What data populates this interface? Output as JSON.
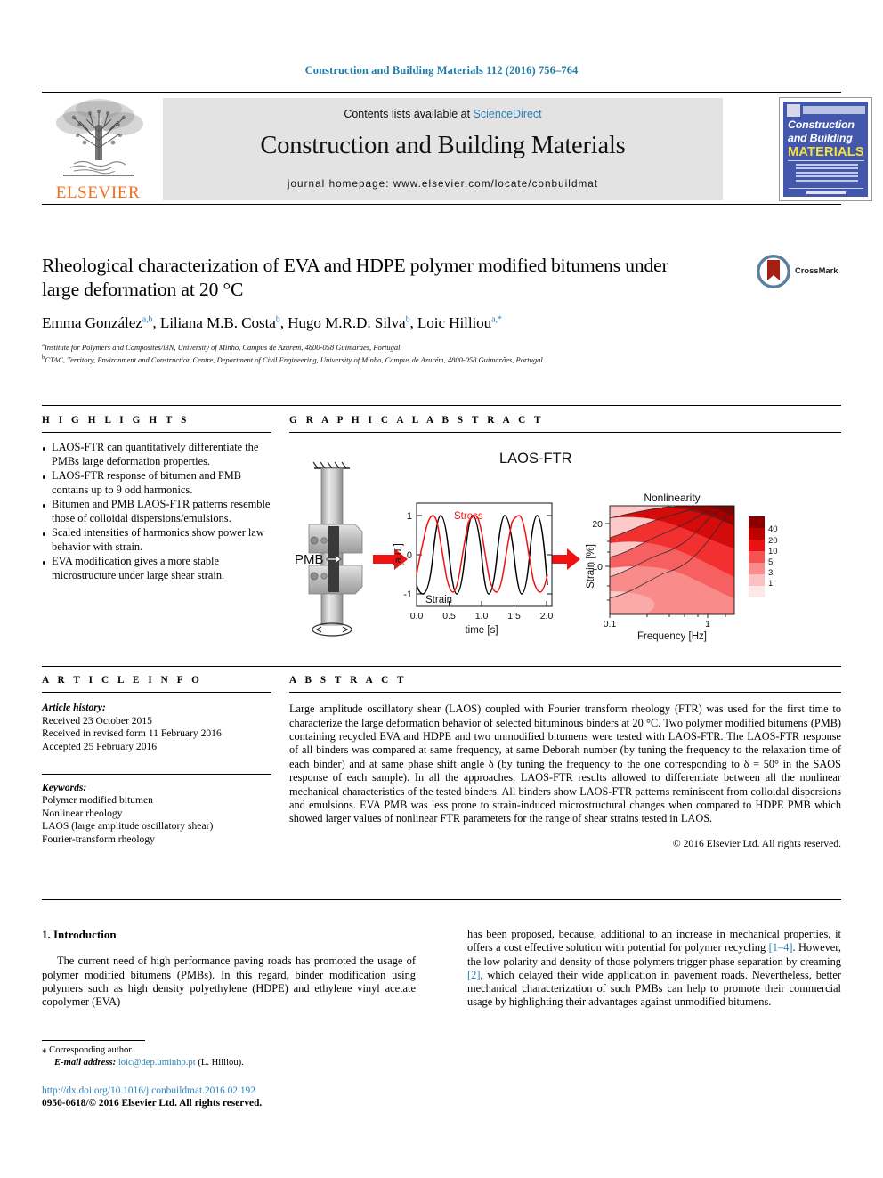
{
  "running_head": "Construction and Building Materials 112 (2016) 756–764",
  "masthead": {
    "contents_prefix": "Contents lists available at ",
    "sciencedirect": "ScienceDirect",
    "journal_title": "Construction and Building Materials",
    "homepage": "journal homepage: www.elsevier.com/locate/conbuildmat",
    "publisher": "ELSEVIER",
    "cover": {
      "line1": "Construction",
      "line2": "and Building",
      "line3": "MATERIALS"
    }
  },
  "article": {
    "title": "Rheological characterization of EVA and HDPE polymer modified bitumens under large deformation at 20 °C",
    "crossmark_label": "CrossMark",
    "authors": [
      {
        "name": "Emma González",
        "sup": "a,b",
        "sep": ", "
      },
      {
        "name": "Liliana M.B. Costa",
        "sup": "b",
        "sep": ", "
      },
      {
        "name": "Hugo M.R.D. Silva",
        "sup": "b",
        "sep": ", "
      },
      {
        "name": "Loic Hilliou",
        "sup": "a,*",
        "sep": ""
      }
    ],
    "affiliations": [
      {
        "marker": "a",
        "text": "Institute for Polymers and Composites/i3N, University of Minho, Campus de Azurém, 4800-058 Guimarães, Portugal"
      },
      {
        "marker": "b",
        "text": "CTAC, Territory, Environment and Construction Centre, Department of Civil Engineering, University of Minho, Campus de Azurém, 4800-058 Guimarães, Portugal"
      }
    ]
  },
  "highlights": {
    "heading": "H I G H L I G H T S",
    "items": [
      "LAOS-FTR can quantitatively differentiate the PMBs large deformation properties.",
      "LAOS-FTR response of bitumen and PMB contains up to 9 odd harmonics.",
      "Bitumen and PMB LAOS-FTR patterns resemble those of colloidal dispersions/emulsions.",
      "Scaled intensities of harmonics show power law behavior with strain.",
      "EVA modification gives a more stable microstructure under large shear strain."
    ]
  },
  "graphical_abstract": {
    "heading": "G R A P H I C A L   A B S T R A C T"
  },
  "article_info": {
    "heading": "A R T I C L E   I N F O",
    "history_label": "Article history:",
    "history": [
      "Received 23 October 2015",
      "Received in revised form 11 February 2016",
      "Accepted 25 February 2016"
    ],
    "keywords_label": "Keywords:",
    "keywords": [
      "Polymer modified bitumen",
      "Nonlinear rheology",
      "LAOS (large amplitude oscillatory shear)",
      "Fourier-transform rheology"
    ]
  },
  "abstract": {
    "heading": "A B S T R A C T",
    "text": "Large amplitude oscillatory shear (LAOS) coupled with Fourier transform rheology (FTR) was used for the first time to characterize the large deformation behavior of selected bituminous binders at 20 °C. Two polymer modified bitumens (PMB) containing recycled EVA and HDPE and two unmodified bitumens were tested with LAOS-FTR. The LAOS-FTR response of all binders was compared at same frequency, at same Deborah number (by tuning the frequency to the relaxation time of each binder) and at same phase shift angle δ (by tuning the frequency to the one corresponding to δ = 50° in the SAOS response of each sample). In all the approaches, LAOS-FTR results allowed to differentiate between all the nonlinear mechanical characteristics of the tested binders. All binders show LAOS-FTR patterns reminiscent from colloidal dispersions and emulsions. EVA PMB was less prone to strain-induced microstructural changes when compared to HDPE PMB which showed larger values of nonlinear FTR parameters for the range of shear strains tested in LAOS.",
    "copyright": "© 2016 Elsevier Ltd. All rights reserved."
  },
  "body": {
    "section_number_title": "1. Introduction",
    "left_paragraph": "The current need of high performance paving roads has promoted the usage of polymer modified bitumens (PMBs). In this regard, binder modification using polymers such as high density polyethylene (HDPE) and ethylene vinyl acetate copolymer (EVA)",
    "right_paragraph_1": "has been proposed, because, additional to an increase in mechanical properties, it offers a cost effective solution with potential for polymer recycling ",
    "right_ref_1": "[1–4]",
    "right_paragraph_2": ". However, the low polarity and density of those polymers trigger phase separation by creaming ",
    "right_ref_2": "[2]",
    "right_paragraph_3": ", which delayed their wide application in pavement roads. Nevertheless, better mechanical characterization of such PMBs can help to promote their commercial usage by highlighting their advantages against unmodified bitumens."
  },
  "footer": {
    "corresponding_marker": "⁎",
    "corresponding_text": "Corresponding author.",
    "email_label": "E-mail address:",
    "email": "loic@dep.uminho.pt",
    "email_owner": "(L. Hilliou).",
    "doi": "http://dx.doi.org/10.1016/j.conbuildmat.2016.02.192",
    "issn_line": "0950-0618/© 2016 Elsevier Ltd. All rights reserved."
  },
  "chart_data": [
    {
      "type": "line",
      "title": "LAOS-FTR",
      "xlabel": "time [s]",
      "ylabel": "[a.u.]",
      "xlim": [
        0.0,
        2.0
      ],
      "ylim": [
        -1.35,
        1.35
      ],
      "xticks": [
        "0.0",
        "0.5",
        "1.0",
        "1.5",
        "2.0"
      ],
      "yticks": [
        "-1",
        "0",
        "1"
      ],
      "grid": false,
      "legend_position": "inline-annotation",
      "series": [
        {
          "name": "Stress",
          "color": "#ee1111",
          "amplitude": 1.0,
          "frequency_hz": 2.0,
          "phase_deg": 28,
          "distorted": true
        },
        {
          "name": "Strain",
          "color": "#000000",
          "amplitude": 1.0,
          "frequency_hz": 2.0,
          "phase_deg": 0,
          "distorted": false
        }
      ]
    },
    {
      "type": "heatmap",
      "title": "Nonlinearity",
      "xlabel": "Frequency [Hz]",
      "ylabel": "Strain [%]",
      "xscale": "log",
      "xticks": [
        "0.1",
        "1"
      ],
      "yticks": [
        "10",
        "20"
      ],
      "colorbar_levels": [
        "40",
        "20",
        "10",
        "5",
        "3",
        "1"
      ],
      "colorbar_colors": [
        "#8f0000",
        "#c00000",
        "#e81212",
        "#f55252",
        "#fa8b8b",
        "#fdc0c0",
        "#fee4e4"
      ],
      "description": "Nonlinearity increases with both frequency and strain; contour bands run diagonally from lower-left (low) to upper-right (high)."
    }
  ],
  "schematic": {
    "label": "PMB"
  }
}
